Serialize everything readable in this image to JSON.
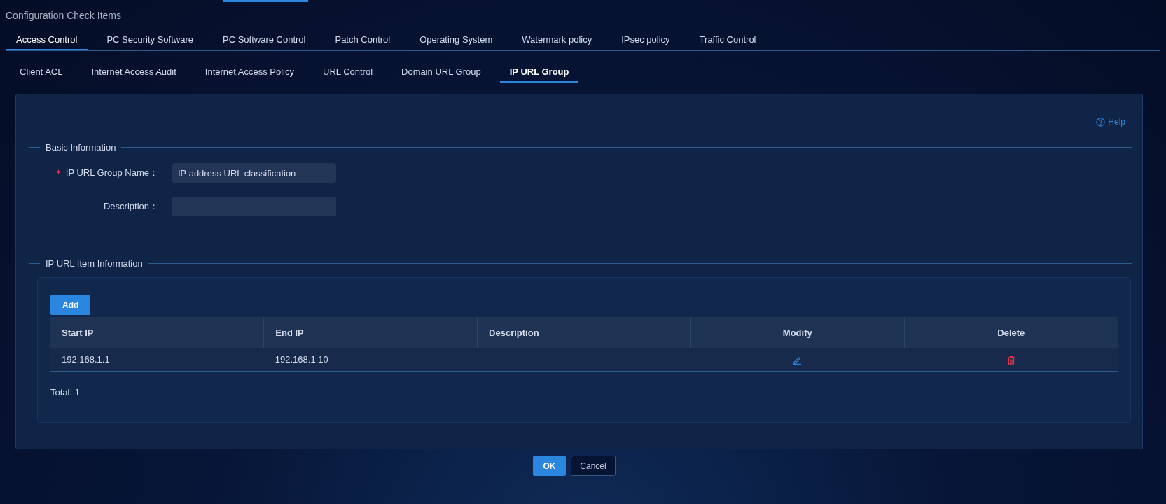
{
  "title": "Configuration Check Items",
  "tabs": [
    {
      "label": "Access Control",
      "selected": true
    },
    {
      "label": "PC Security Software",
      "selected": false
    },
    {
      "label": "PC Software Control",
      "selected": false
    },
    {
      "label": "Patch Control",
      "selected": false
    },
    {
      "label": "Operating System",
      "selected": false
    },
    {
      "label": "Watermark policy",
      "selected": false
    },
    {
      "label": "IPsec policy",
      "selected": false
    },
    {
      "label": "Traffic Control",
      "selected": false
    }
  ],
  "subtabs": [
    {
      "label": "Client ACL",
      "selected": false
    },
    {
      "label": "Internet Access Audit",
      "selected": false
    },
    {
      "label": "Internet Access Policy",
      "selected": false
    },
    {
      "label": "URL Control",
      "selected": false
    },
    {
      "label": "Domain URL Group",
      "selected": false
    },
    {
      "label": "IP URL Group",
      "selected": true
    }
  ],
  "help": "Help",
  "basic_section": {
    "legend": "Basic Information",
    "fields": [
      {
        "label": "IP URL Group Name：",
        "required": true,
        "value": "IP address URL classification"
      },
      {
        "label": "Description：",
        "required": false
      }
    ]
  },
  "items_section": {
    "legend": "IP URL Item Information",
    "add_button": "Add",
    "table": {
      "columns": [
        "Start IP",
        "End IP",
        "Description",
        "Modify",
        "Delete"
      ],
      "rows": [
        {
          "start_ip": "192.168.1.1",
          "end_ip": "192.168.1.10"
        }
      ]
    },
    "total": "Total: 1"
  },
  "buttons": {
    "ok": "OK",
    "cancel": "Cancel"
  }
}
